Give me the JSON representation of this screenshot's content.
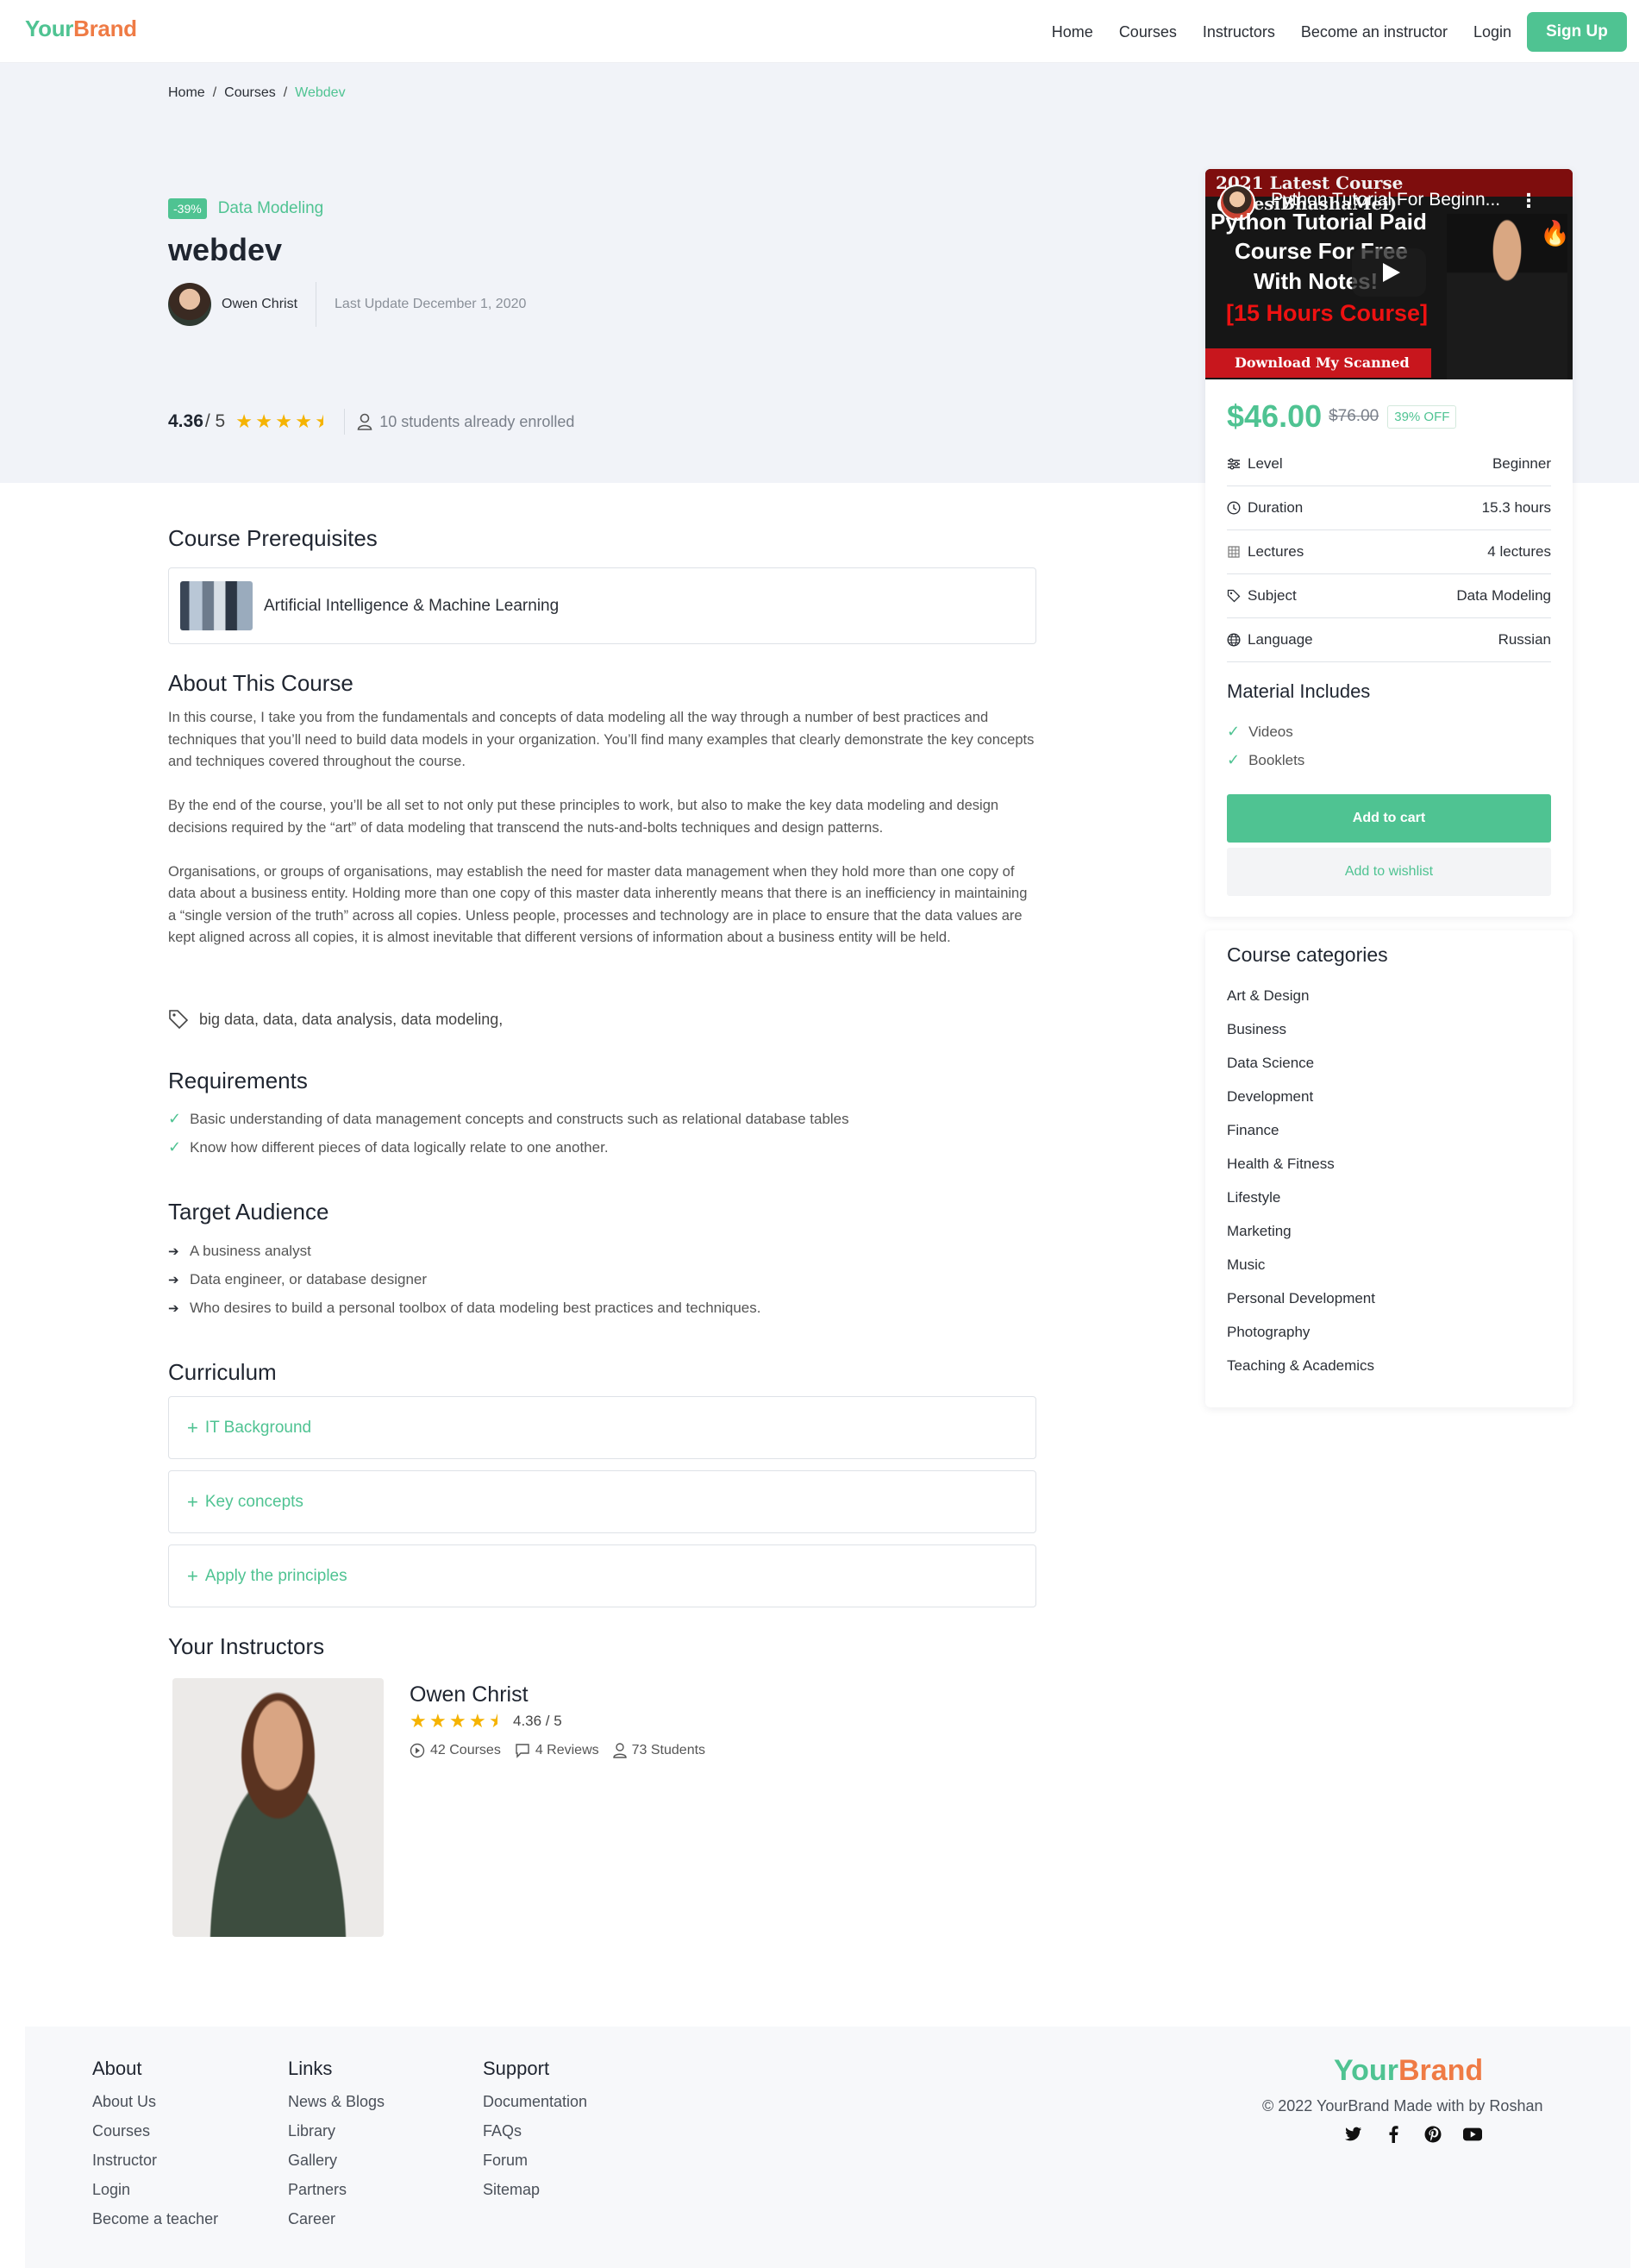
{
  "brand": {
    "part1": "Your",
    "part2": "Brand"
  },
  "nav": {
    "items": [
      "Home",
      "Courses",
      "Instructors",
      "Become an instructor",
      "Login"
    ],
    "signup": "Sign Up"
  },
  "breadcrumb": {
    "home": "Home",
    "courses": "Courses",
    "current": "Webdev"
  },
  "course": {
    "discount": "-39%",
    "subject": "Data Modeling",
    "title": "webdev",
    "instructor": "Owen Christ",
    "last_update": "Last Update December 1, 2020",
    "rating": "4.36",
    "rating_of": "/ 5",
    "enrolled": "10 students already enrolled"
  },
  "video": {
    "banner": "2021 Latest Course (#DesiBhashaMei)",
    "title": "Python Tutorial For Beginn...",
    "line1": "Python Tutorial Paid",
    "line2": "Course For Free",
    "line3": "With Notes!",
    "line4": "[15 Hours Course]",
    "bottom": "Download My Scanned Notes"
  },
  "pricing": {
    "price": "$46.00",
    "old_price": "$76.00",
    "off": "39% OFF"
  },
  "info": [
    {
      "label": "Level",
      "value": "Beginner",
      "icon": "sliders-icon"
    },
    {
      "label": "Duration",
      "value": "15.3 hours",
      "icon": "clock-icon"
    },
    {
      "label": "Lectures",
      "value": "4 lectures",
      "icon": "grid-icon"
    },
    {
      "label": "Subject",
      "value": "Data Modeling",
      "icon": "tag-icon"
    },
    {
      "label": "Language",
      "value": "Russian",
      "icon": "globe-icon"
    }
  ],
  "material": {
    "title": "Material Includes",
    "items": [
      "Videos",
      "Booklets"
    ]
  },
  "buttons": {
    "cart": "Add to cart",
    "wishlist": "Add to wishlist"
  },
  "categories": {
    "title": "Course categories",
    "items": [
      "Art & Design",
      "Business",
      "Data Science",
      "Development",
      "Finance",
      "Health & Fitness",
      "Lifestyle",
      "Marketing",
      "Music",
      "Personal Development",
      "Photography",
      "Teaching & Academics"
    ]
  },
  "prereq": {
    "title": "Course Prerequisites",
    "item": "Artificial Intelligence & Machine Learning"
  },
  "about": {
    "title": "About This Course",
    "p1": "In this course, I take you from the fundamentals and concepts of data modeling all the way through a number of best practices and techniques that you’ll need to build data models in your organization. You’ll find many examples that clearly demonstrate the key concepts and techniques covered throughout the course.",
    "p2": "By the end of the course, you’ll be all set to not only put these principles to work, but also to make the key data modeling and design decisions required by the “art” of data modeling that transcend the nuts-and-bolts techniques and design patterns.",
    "p3": "Organisations, or groups of organisations, may establish the need for master data management when they hold more than one copy of data about a business entity. Holding more than one copy of this master data inherently means that there is an inefficiency in maintaining a “single version of the truth” across all copies. Unless people, processes and technology are in place to ensure that the data values are kept aligned across all copies, it is almost inevitable that different versions of information about a business entity will be held.",
    "tags": "big data, data, data analysis, data modeling,"
  },
  "requirements": {
    "title": "Requirements",
    "items": [
      "Basic understanding of data management concepts and constructs such as relational database tables",
      "Know how different pieces of data logically relate to one another."
    ]
  },
  "audience": {
    "title": "Target Audience",
    "items": [
      "A business analyst",
      "Data engineer, or database designer",
      "Who desires to build a personal toolbox of data modeling best practices and techniques."
    ]
  },
  "curriculum": {
    "title": "Curriculum",
    "items": [
      "IT Background",
      "Key concepts",
      "Apply the principles"
    ]
  },
  "instructors": {
    "title": "Your Instructors",
    "name": "Owen Christ",
    "rating": "4.36 / 5",
    "courses": "42 Courses",
    "reviews": "4 Reviews",
    "students": "73 Students"
  },
  "footer": {
    "about": {
      "title": "About",
      "items": [
        "About Us",
        "Courses",
        "Instructor",
        "Login",
        "Become a teacher"
      ]
    },
    "links": {
      "title": "Links",
      "items": [
        "News & Blogs",
        "Library",
        "Gallery",
        "Partners",
        "Career"
      ]
    },
    "support": {
      "title": "Support",
      "items": [
        "Documentation",
        "FAQs",
        "Forum",
        "Sitemap"
      ]
    },
    "copyright": "© 2022 YourBrand Made with by Roshan",
    "social": [
      "twitter-icon",
      "facebook-icon",
      "pinterest-icon",
      "youtube-icon"
    ]
  },
  "colors": {
    "accent": "#4fc392",
    "brand_orange": "#ef7b45"
  }
}
